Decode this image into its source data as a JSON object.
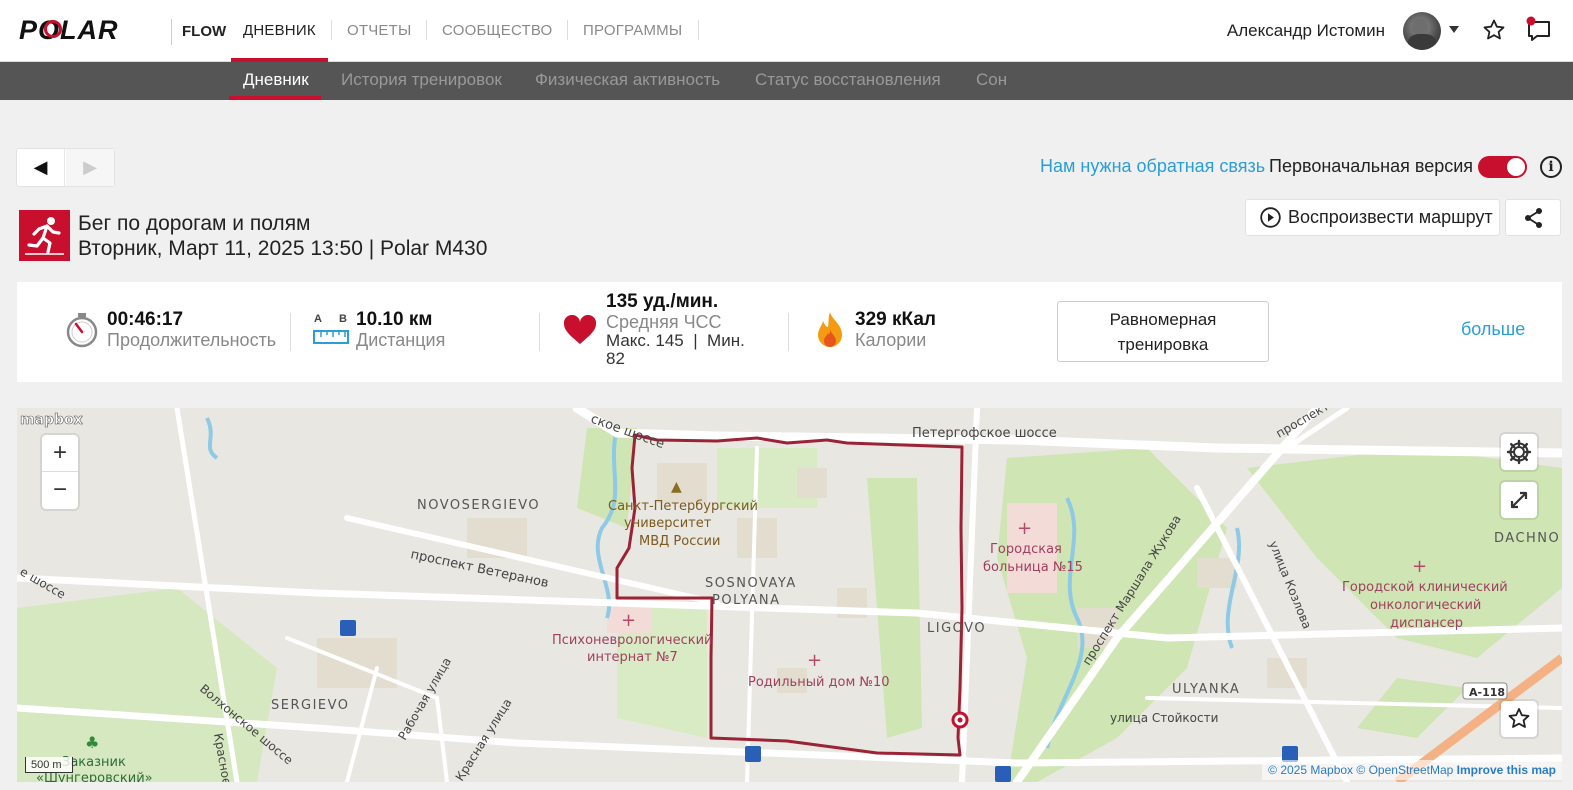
{
  "brand": {
    "logo_text": "POLAR",
    "product": "FLOW"
  },
  "main_nav": [
    "ДНЕВНИК",
    "ОТЧЕТЫ",
    "СООБЩЕСТВО",
    "ПРОГРАММЫ"
  ],
  "main_nav_active": "ДНЕВНИК",
  "user": {
    "name": "Александр Истомин"
  },
  "sub_nav": [
    "Дневник",
    "История тренировок",
    "Физическая активность",
    "Статус восстановления",
    "Сон"
  ],
  "sub_nav_active": "Дневник",
  "toolbar": {
    "prev_arrow": "◀",
    "next_arrow": "▶",
    "feedback_link": "Нам нужна обратная связь",
    "original_version_label": "Первоначальная версия",
    "original_version_on": true,
    "info_glyph": "i"
  },
  "session": {
    "sport": "Бег по дорогам и полям",
    "subtitle": "Вторник, Март 11, 2025 13:50 | Polar M430",
    "play_route_label": "Воспроизвести маршрут"
  },
  "stats": {
    "duration": {
      "value": "00:46:17",
      "label": "Продолжительность"
    },
    "distance": {
      "value": "10.10 км",
      "label": "Дистанция",
      "icon_a": "A",
      "icon_b": "B"
    },
    "heart_rate": {
      "value": "135 уд./мин.",
      "label": "Средняя ЧСС",
      "minmax": "Макс. 145  |  Мин.",
      "min_value": "82"
    },
    "calories": {
      "value": "329 кКал",
      "label": "Калории"
    },
    "benefit_line1": "Равномерная",
    "benefit_line2": "тренировка",
    "more_link": "больше"
  },
  "map": {
    "logo": "mapbox",
    "zoom_in": "+",
    "zoom_out": "−",
    "scale": "500 m",
    "attribution_copy": "© 2025 Mapbox",
    "attribution_osm": "© OpenStreetMap",
    "attribution_improve": "Improve this map",
    "labels": {
      "road_top": "Петергофское шоссе",
      "road_top_left": "ское шоссе",
      "road_top_right": "проспект Сто",
      "university_1": "Санкт-Петербургский",
      "university_2": "университет",
      "university_3": "МВД России",
      "novosergievo": "NOVOSERGIEVO",
      "sosnovaya_1": "SOSNOVAYA",
      "sosnovaya_2": "POLYANA",
      "veteranov": "проспект Ветеранов",
      "psycho_1": "Психоневрологический",
      "psycho_2": "интернат №7",
      "maternity": "Родильный дом №10",
      "hospital_1": "Городская",
      "hospital_2": "больница №15",
      "ligovo": "LIGOVO",
      "zhukova": "проспект Маршала Жукова",
      "kozlova": "улица Козлова",
      "onco_1": "Городской клинический",
      "onco_2": "онкологический",
      "onco_3": "диспансер",
      "dachno": "DACHNO",
      "ulyanka": "ULYANKA",
      "stoykosti": "улица Стойкости",
      "a118": "А-118",
      "sergievo": "SERGIEVO",
      "volkhonskoe": "Волхонское шоссе",
      "rabochaya": "Рабочая улица",
      "krasnaya": "Красная улица",
      "krasnoe": "Красное",
      "left_shosse": "е шоссе",
      "zakaznik_1": "Заказник",
      "zakaznik_2": "«Шунгеровский»"
    }
  },
  "colors": {
    "accent": "#c8102e",
    "link": "#2a9fd6",
    "route": "#9b2335",
    "subnav_bg": "#555555"
  }
}
